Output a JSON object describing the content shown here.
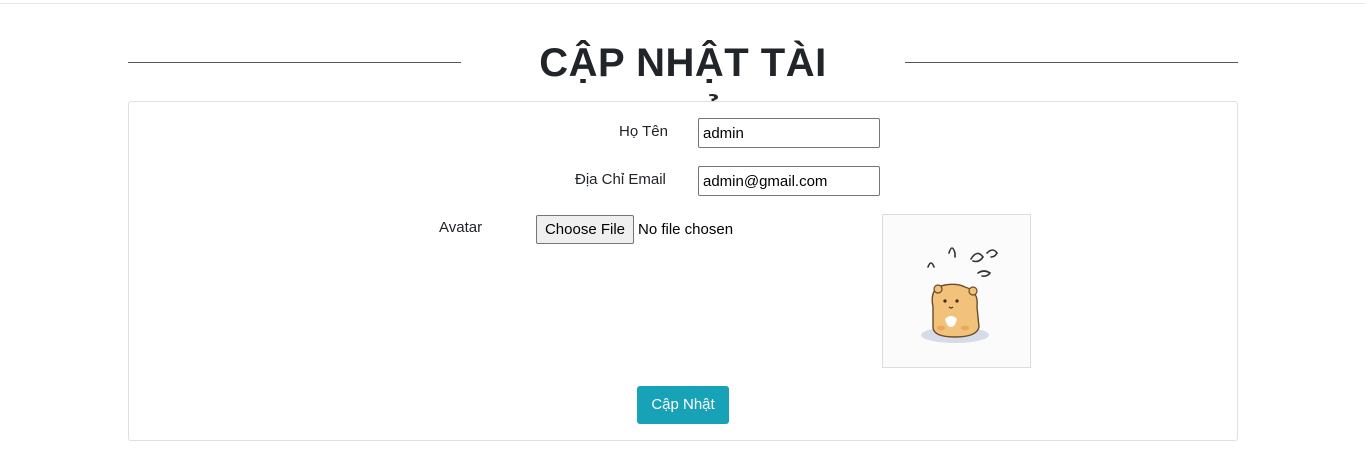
{
  "page": {
    "title": "CẬP NHẬT TÀI KHOẢN"
  },
  "form": {
    "name_label": "Họ Tên",
    "name_value": "admin",
    "email_label": "Địa Chỉ Email",
    "email_value": "admin@gmail.com",
    "avatar_label": "Avatar",
    "file_button_label": "Choose File",
    "file_status": "No file chosen",
    "submit_label": "Cập Nhật"
  },
  "colors": {
    "accent": "#17a2b8",
    "text": "#212529",
    "border": "#dfdfdf"
  },
  "icons": {
    "avatar_image": "hamster-illustration"
  }
}
